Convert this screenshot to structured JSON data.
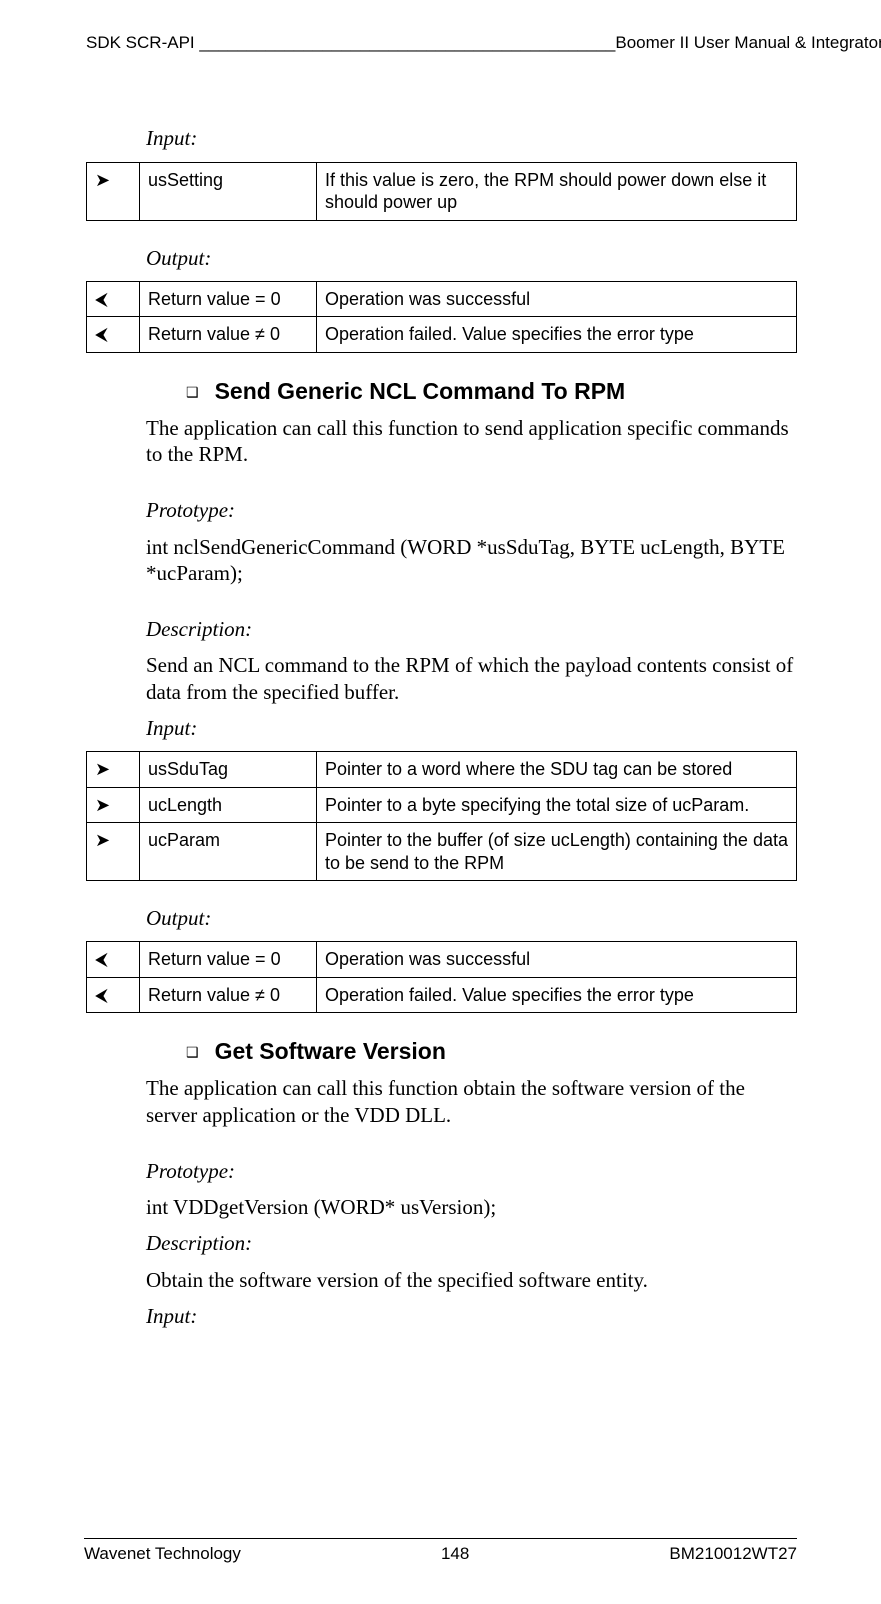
{
  "header": {
    "left": "SDK SCR-API",
    "line": "____________________________________________",
    "right": "Boomer II User Manual & Integrator's Guide"
  },
  "s1": {
    "input_label": "Input:",
    "input_rows": [
      {
        "arrow": "➤",
        "name": "usSetting",
        "desc": "If this value is zero, the RPM should power down else it should power up"
      }
    ],
    "output_label": "Output:",
    "output_rows": [
      {
        "arrow": "⮜",
        "name": "Return value = 0",
        "desc": "Operation was successful"
      },
      {
        "arrow": "⮜",
        "name": "Return value  ≠ 0",
        "desc": "Operation failed. Value specifies the error type"
      }
    ]
  },
  "sec2": {
    "title": "Send Generic NCL Command To RPM",
    "intro": "The application can call this function to send application specific commands to the RPM.",
    "proto_label": "Prototype:",
    "proto_text": "int nclSendGenericCommand (WORD *usSduTag, BYTE ucLength, BYTE *ucParam);",
    "desc_label": "Description:",
    "desc_text": "Send an NCL command to the RPM of which the payload contents consist of data from the specified buffer.",
    "input_label": "Input:",
    "input_rows": [
      {
        "arrow": "➤",
        "name": "usSduTag",
        "desc": "Pointer to a word where the SDU tag can be stored"
      },
      {
        "arrow": "➤",
        "name": "ucLength",
        "desc": "Pointer to a byte specifying the total size of ucParam."
      },
      {
        "arrow": "➤",
        "name": "ucParam",
        "desc": "Pointer to the buffer (of size ucLength) containing the data to be send to the RPM"
      }
    ],
    "output_label": "Output:",
    "output_rows": [
      {
        "arrow": "⮜",
        "name": "Return value = 0",
        "desc": "Operation was successful"
      },
      {
        "arrow": "⮜",
        "name": "Return value  ≠ 0",
        "desc": "Operation failed. Value specifies the error type"
      }
    ]
  },
  "sec3": {
    "title": "Get Software Version",
    "intro": "The application can call this function obtain the software version of the server application or the VDD DLL.",
    "proto_label": "Prototype:",
    "proto_text": "int VDDgetVersion (WORD* usVersion);",
    "desc_label": "Description:",
    "desc_text": "Obtain the software version of the specified software entity.",
    "input_label": "Input:"
  },
  "footer": {
    "left": "Wavenet Technology",
    "center": "148",
    "right": "BM210012WT27"
  },
  "bullet_glyph": "❑"
}
